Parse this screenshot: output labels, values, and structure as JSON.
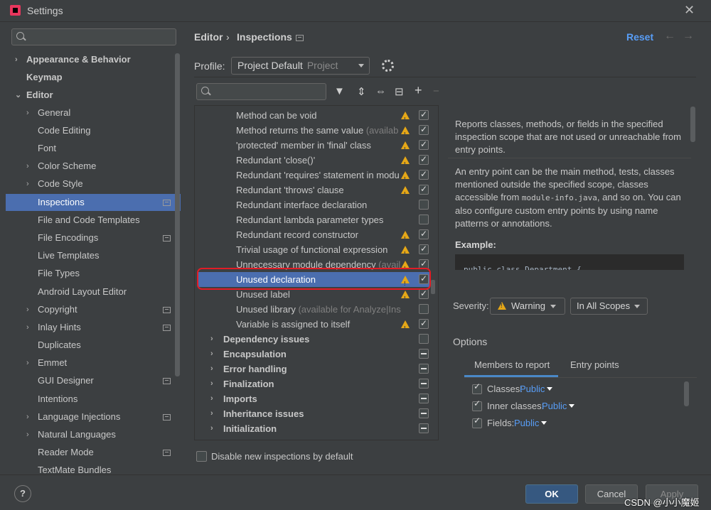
{
  "window": {
    "title": "Settings"
  },
  "search": {
    "placeholder": ""
  },
  "sidebar": {
    "items": [
      {
        "label": "Appearance & Behavior"
      },
      {
        "label": "Keymap"
      },
      {
        "label": "Editor"
      },
      {
        "label": "General"
      },
      {
        "label": "Code Editing"
      },
      {
        "label": "Font"
      },
      {
        "label": "Color Scheme"
      },
      {
        "label": "Code Style"
      },
      {
        "label": "Inspections"
      },
      {
        "label": "File and Code Templates"
      },
      {
        "label": "File Encodings"
      },
      {
        "label": "Live Templates"
      },
      {
        "label": "File Types"
      },
      {
        "label": "Android Layout Editor"
      },
      {
        "label": "Copyright"
      },
      {
        "label": "Inlay Hints"
      },
      {
        "label": "Duplicates"
      },
      {
        "label": "Emmet"
      },
      {
        "label": "GUI Designer"
      },
      {
        "label": "Intentions"
      },
      {
        "label": "Language Injections"
      },
      {
        "label": "Natural Languages"
      },
      {
        "label": "Reader Mode"
      },
      {
        "label": "TextMate Bundles"
      }
    ]
  },
  "header": {
    "crumb1": "Editor",
    "separator": "›",
    "crumb2": "Inspections",
    "reset": "Reset",
    "back_arrow": "←",
    "forward_arrow": "→"
  },
  "profile": {
    "label": "Profile:",
    "value": "Project Default",
    "hint": "Project"
  },
  "toolbar": {
    "filter": "▼",
    "expand": "⇕",
    "collapse": "⇔",
    "reset_icon": "⊟",
    "add": "+",
    "remove": "−"
  },
  "inspections": [
    {
      "label": "Method can be void",
      "hint": ""
    },
    {
      "label": "Method returns the same value",
      "hint": "(availab"
    },
    {
      "label": "'protected' member in 'final' class",
      "hint": ""
    },
    {
      "label": "Redundant 'close()'",
      "hint": ""
    },
    {
      "label": "Redundant 'requires' statement in modu",
      "hint": ""
    },
    {
      "label": "Redundant 'throws' clause",
      "hint": ""
    },
    {
      "label": "Redundant interface declaration",
      "hint": ""
    },
    {
      "label": "Redundant lambda parameter types",
      "hint": ""
    },
    {
      "label": "Redundant record constructor",
      "hint": ""
    },
    {
      "label": "Trivial usage of functional expression",
      "hint": ""
    },
    {
      "label": "Unnecessary module dependency",
      "hint": "(avail"
    },
    {
      "label": "Unused declaration",
      "hint": ""
    },
    {
      "label": "Unused label",
      "hint": ""
    },
    {
      "label": "Unused library",
      "hint": "(available for Analyze|Ins"
    },
    {
      "label": "Variable is assigned to itself",
      "hint": ""
    },
    {
      "label": "Dependency issues",
      "hint": ""
    },
    {
      "label": "Encapsulation",
      "hint": ""
    },
    {
      "label": "Error handling",
      "hint": ""
    },
    {
      "label": "Finalization",
      "hint": ""
    },
    {
      "label": "Imports",
      "hint": ""
    },
    {
      "label": "Inheritance issues",
      "hint": ""
    },
    {
      "label": "Initialization",
      "hint": ""
    }
  ],
  "description": {
    "p1": "Reports classes, methods, or fields in the specified inspection scope that are not used or unreachable from entry points.",
    "p2_a": "An entry point can be the main method, tests, classes mentioned outside the specified scope, classes accessible from ",
    "p2_code": "module-info.java",
    "p2_b": ", and so on. You can also configure custom entry points by using name patterns or annotations.",
    "example_label": "Example:",
    "example_code": "public class Department {"
  },
  "severity": {
    "label": "Severity:",
    "value": "Warning",
    "scope": "In All Scopes"
  },
  "options": {
    "label": "Options",
    "tab_members": "Members to report",
    "tab_entry": "Entry points",
    "rows": [
      {
        "label": "Classes:",
        "value": "Public"
      },
      {
        "label": "Inner classes:",
        "value": "Public"
      },
      {
        "label": "Fields:",
        "value": "Public"
      }
    ]
  },
  "footer": {
    "disable_label": "Disable new inspections by default",
    "help": "?",
    "ok": "OK",
    "cancel": "Cancel",
    "apply": "Apply",
    "watermark": "CSDN @小小魔姬"
  }
}
